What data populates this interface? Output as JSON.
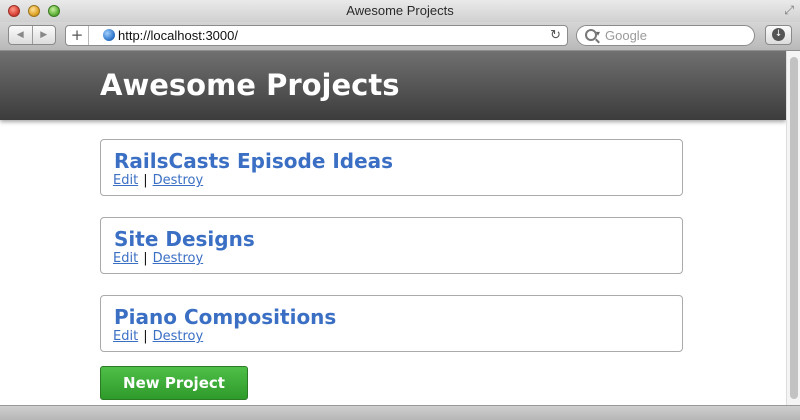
{
  "window": {
    "title": "Awesome Projects"
  },
  "toolbar": {
    "back_glyph": "◀",
    "forward_glyph": "▶",
    "plus_glyph": "+",
    "url": "http://localhost:3000/",
    "reload_glyph": "↻",
    "search_placeholder": "Google",
    "downloads_glyph": "↓"
  },
  "page": {
    "heading": "Awesome Projects",
    "projects": [
      {
        "name": "RailsCasts Episode Ideas",
        "edit_label": "Edit",
        "separator": "|",
        "destroy_label": "Destroy"
      },
      {
        "name": "Site Designs",
        "edit_label": "Edit",
        "separator": "|",
        "destroy_label": "Destroy"
      },
      {
        "name": "Piano Compositions",
        "edit_label": "Edit",
        "separator": "|",
        "destroy_label": "Destroy"
      }
    ],
    "new_project_label": "New Project"
  },
  "colors": {
    "link": "#3a6fc4",
    "header_top": "#707070",
    "header_bottom": "#3c3c3c",
    "button_green": "#38a935"
  },
  "icons": {
    "close": "close-icon",
    "minimize": "minimize-icon",
    "zoom": "zoom-icon",
    "fullscreen": "fullscreen-icon",
    "globe": "globe-icon",
    "search": "search-icon",
    "reload": "reload-icon",
    "downloads": "downloads-icon"
  }
}
